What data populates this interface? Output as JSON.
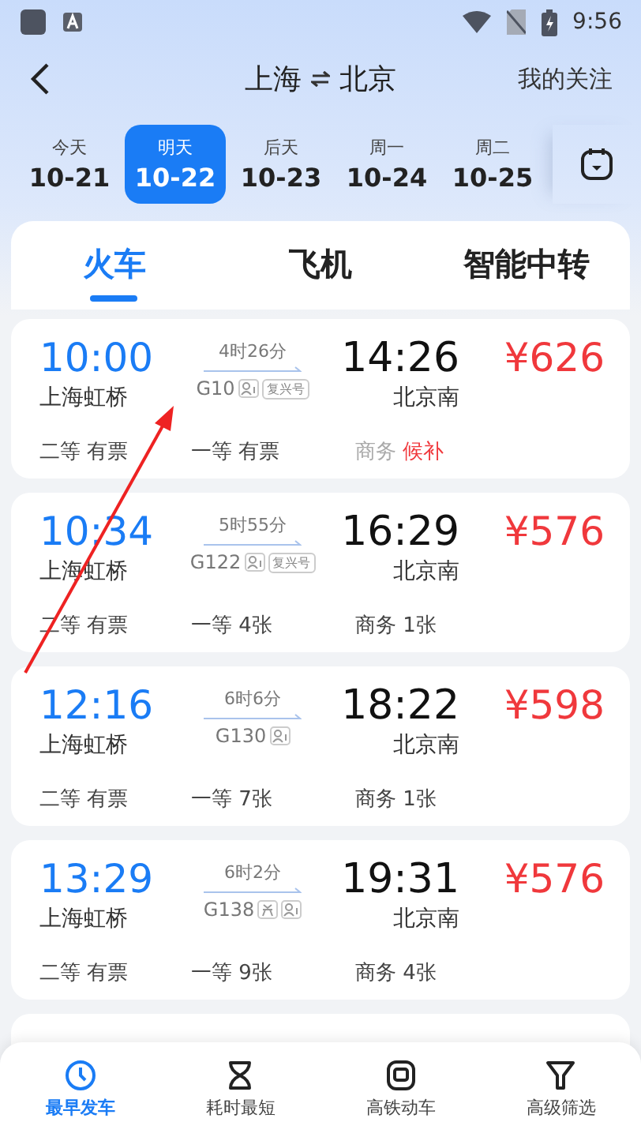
{
  "status_bar": {
    "time": "9:56"
  },
  "header": {
    "title_from": "上海",
    "title_to": "北京",
    "action": "我的关注"
  },
  "dates": [
    {
      "day": "今天",
      "date": "10-21",
      "selected": false
    },
    {
      "day": "明天",
      "date": "10-22",
      "selected": true
    },
    {
      "day": "后天",
      "date": "10-23",
      "selected": false
    },
    {
      "day": "周一",
      "date": "10-24",
      "selected": false
    },
    {
      "day": "周二",
      "date": "10-25",
      "selected": false
    }
  ],
  "tabs": [
    {
      "label": "火车",
      "selected": true
    },
    {
      "label": "飞机",
      "selected": false
    },
    {
      "label": "智能中转",
      "selected": false
    }
  ],
  "trains": [
    {
      "depart": "10:00",
      "from": "上海虹桥",
      "duration": "4时26分",
      "number": "G10",
      "tags": [
        {
          "kind": "seat-pick"
        },
        {
          "kind": "label",
          "text": "复兴号"
        }
      ],
      "arrive": "14:26",
      "to": "北京南",
      "price": "¥626",
      "seats": [
        {
          "class": "二等",
          "status": "有票",
          "waitlist": false
        },
        {
          "class": "一等",
          "status": "有票",
          "waitlist": false
        },
        {
          "class": "商务",
          "status": "候补",
          "waitlist": true
        }
      ]
    },
    {
      "depart": "10:34",
      "from": "上海虹桥",
      "duration": "5时55分",
      "number": "G122",
      "tags": [
        {
          "kind": "seat-pick"
        },
        {
          "kind": "label",
          "text": "复兴号"
        }
      ],
      "arrive": "16:29",
      "to": "北京南",
      "price": "¥576",
      "seats": [
        {
          "class": "二等",
          "status": "有票",
          "waitlist": false
        },
        {
          "class": "一等",
          "status": "4张",
          "waitlist": false
        },
        {
          "class": "商务",
          "status": "1张",
          "waitlist": false
        }
      ]
    },
    {
      "depart": "12:16",
      "from": "上海虹桥",
      "duration": "6时6分",
      "number": "G130",
      "tags": [
        {
          "kind": "seat-pick"
        }
      ],
      "arrive": "18:22",
      "to": "北京南",
      "price": "¥598",
      "seats": [
        {
          "class": "二等",
          "status": "有票",
          "waitlist": false
        },
        {
          "class": "一等",
          "status": "7张",
          "waitlist": false
        },
        {
          "class": "商务",
          "status": "1张",
          "waitlist": false
        }
      ]
    },
    {
      "depart": "13:29",
      "from": "上海虹桥",
      "duration": "6时2分",
      "number": "G138",
      "tags": [
        {
          "kind": "exchange"
        },
        {
          "kind": "seat-pick"
        }
      ],
      "arrive": "19:31",
      "to": "北京南",
      "price": "¥576",
      "seats": [
        {
          "class": "二等",
          "status": "有票",
          "waitlist": false
        },
        {
          "class": "一等",
          "status": "9张",
          "waitlist": false
        },
        {
          "class": "商务",
          "status": "4张",
          "waitlist": false
        }
      ]
    }
  ],
  "bottom_nav": [
    {
      "label": "最早发车",
      "selected": true
    },
    {
      "label": "耗时最短",
      "selected": false
    },
    {
      "label": "高铁动车",
      "selected": false
    },
    {
      "label": "高级筛选",
      "selected": false
    }
  ]
}
